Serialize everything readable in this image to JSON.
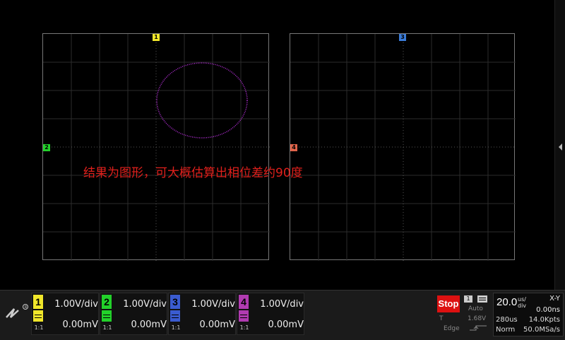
{
  "annotation": "结果为图形，可大概估算出相位差约90度",
  "grid_left": {
    "top_marker": "1",
    "left_marker": "2"
  },
  "grid_right": {
    "top_marker": "3",
    "left_marker": "4"
  },
  "channels": [
    {
      "num": "1",
      "scale": "1.00V/div",
      "offset": "0.00mV",
      "ratio": "1:1",
      "color": "#f0e62a"
    },
    {
      "num": "2",
      "scale": "1.00V/div",
      "offset": "0.00mV",
      "ratio": "1:1",
      "color": "#22d12a"
    },
    {
      "num": "3",
      "scale": "1.00V/div",
      "offset": "0.00mV",
      "ratio": "1:1",
      "color": "#3a5bd0"
    },
    {
      "num": "4",
      "scale": "1.00V/div",
      "offset": "0.00mV",
      "ratio": "1:1",
      "color": "#b03bb0"
    }
  ],
  "run_state": "Stop",
  "trigger": {
    "source": "1",
    "mode": "Auto",
    "type_label": "T",
    "level": "1.68V",
    "edge": "Edge"
  },
  "timebase": {
    "value": "20.0",
    "unit_top": "us/",
    "unit_bottom": "div",
    "mode": "X-Y",
    "delay": "0.00ns",
    "memory_time": "280us",
    "memory_depth": "14.0Kpts",
    "acq_mode": "Norm",
    "sample_rate": "50.0MSa/s"
  },
  "colors": {
    "trace_xy": "#b32fd6",
    "grid": "#2c2c2c",
    "marker_ch4": "#e0644a"
  }
}
